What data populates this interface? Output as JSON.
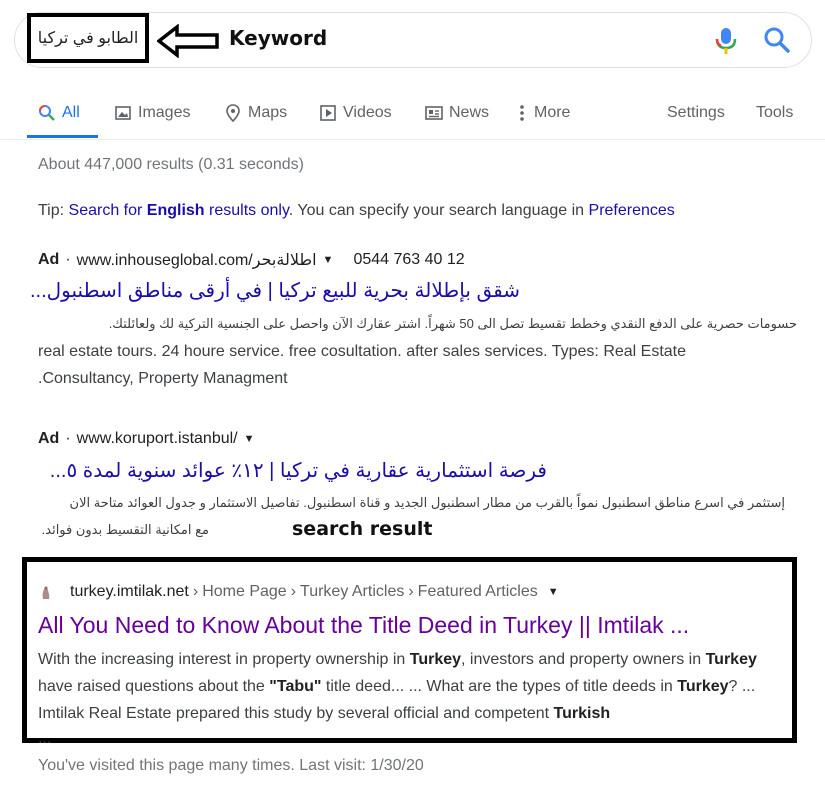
{
  "search": {
    "query": "الطابو في تركيا",
    "annotation_keyword": "Keyword"
  },
  "tabs": [
    {
      "label": "All",
      "icon": "search-icon",
      "active": true
    },
    {
      "label": "Images",
      "icon": "image-icon"
    },
    {
      "label": "Maps",
      "icon": "map-pin-icon"
    },
    {
      "label": "Videos",
      "icon": "video-icon"
    },
    {
      "label": "News",
      "icon": "news-icon"
    },
    {
      "label": "More",
      "icon": "more-vert-icon"
    }
  ],
  "tools": {
    "settings": "Settings",
    "tools": "Tools"
  },
  "stats": "About 447,000 results (0.31 seconds)",
  "tip": {
    "prefix": "Tip: ",
    "link_pre": "Search for ",
    "link_bold": "English",
    "link_post": " results only",
    "middle": ". You can specify your search language in ",
    "pref_link": "Preferences"
  },
  "ads": [
    {
      "label": "Ad",
      "url": "www.inhouseglobal.com/اطلالةبحر",
      "phone": "0544 763 40 12",
      "title": "شقق بإطلالة بحرية للبيع تركيا | في أرقى مناطق اسطنبول...",
      "desc_ar": "حسومات حصرية على الدفع النقدي وخطط تقسيط تصل الى 50 شهراً. اشتر عقارك الآن واحصل على الجنسية التركية لك ولعائلتك.",
      "desc_en_1": "real estate tours. 24 houre service. free cosultation. after sales services. Types: Real Estate",
      "desc_en_2": ".Consultancy, Property Managment"
    },
    {
      "label": "Ad",
      "url": "www.koruport.istanbul/",
      "title": "فرصة استثمارية عقارية في تركيا | ١٢٪ عوائد سنوية لمدة ٥...",
      "desc_ar_1": "إستثمر في اسرع مناطق اسطنبول نمواً بالقرب من مطار اسطنبول الجديد و قناة اسطنبول. تفاصيل الاستثمار و جدول العوائد متاحة الان",
      "desc_ar_2": "مع امكانية التقسيط بدون فوائد."
    }
  ],
  "annotation_search_result": "search result",
  "result": {
    "site": "turkey.imtilak.net",
    "crumbs": [
      "Home Page",
      "Turkey Articles",
      "Featured Articles"
    ],
    "title": "All You Need to Know About the Title Deed in Turkey || Imtilak ...",
    "snippet": {
      "s1": "With the increasing interest in property ownership in ",
      "b1": "Turkey",
      "s2": ", investors and property owners in ",
      "b2": "Turkey",
      "s3": " have raised questions about the ",
      "b3": "\"Tabu\"",
      "s4": " title deed... ... What are the types of title deeds in ",
      "b4": "Turkey",
      "s5": "? ... Imtilak Real Estate prepared this study by several official and competent ",
      "b5": "Turkish"
    },
    "ellipsis": "...",
    "visited": "You've visited this page many times. Last visit: 1/30/20"
  },
  "colors": {
    "link": "#1a0dab",
    "visited": "#660099",
    "accent": "#1a73e8",
    "muted": "#70757a"
  }
}
